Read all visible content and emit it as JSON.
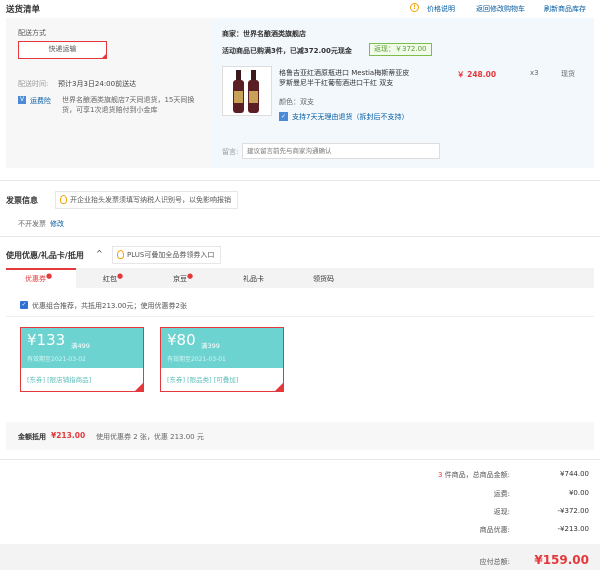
{
  "header": {
    "title": "送货清单",
    "links": [
      "价格说明",
      "返回修改购物车",
      "刷新商品库存"
    ],
    "info_icon": "!"
  },
  "delivery": {
    "label": "配送方式",
    "option": "快递运输",
    "time_label": "配送时间:",
    "time_value": "预计3月3日24:00前送达",
    "insure_icon": "V",
    "insure_label": "运费险",
    "insure_text": "世界名酿酒类旗舰店7天同退货，15天同换货，可享1次退货赔付到小金库"
  },
  "shop": {
    "name": "商家：世界名酿酒类旗舰店",
    "promo": "活动商品已购满3件，已减372.00元现金",
    "rebate": "返现：￥372.00",
    "product": {
      "name": "格鲁吉亚红酒原瓶进口 Mestia梅斯蒂亚皮罗斯曼尼半干红葡萄酒进口干红 双支",
      "price": "￥ 248.00",
      "qty": "x3",
      "stock": "现货",
      "color": "颜色：双支",
      "return_icon": "✓",
      "return_text": "支持7天无理由退货（拆封后不支持）"
    },
    "note_label": "留言:",
    "note_placeholder": "建议留言前先与商家沟通确认"
  },
  "invoice": {
    "title": "发票信息",
    "tip": "开企业抬头发票须填写纳税人识别号，以免影响报销",
    "status": "不开发票",
    "edit": "修改"
  },
  "coupons": {
    "title": "使用优惠/礼品卡/抵用",
    "caret": "^",
    "plus_tip": "PLUS可叠加全品券领券入口",
    "tabs": [
      {
        "label": "优惠券",
        "dot": "●"
      },
      {
        "label": "红包",
        "dot": "●"
      },
      {
        "label": "京豆",
        "dot": "●"
      },
      {
        "label": "礼品卡",
        "dot": ""
      },
      {
        "label": "领货码",
        "dot": ""
      }
    ],
    "check_icon": "✓",
    "combo_text": "优惠组合推荐，共抵用213.00元；使用优惠券2张",
    "items": [
      {
        "amount": "¥133",
        "threshold": "满499",
        "expiry": "有效期至2021-03-02",
        "tags": "[东券]  [限店铺指商品]"
      },
      {
        "amount": "¥80",
        "threshold": "满399",
        "expiry": "有效期至2021-03-01",
        "tags": "[东券]  [限品类]  [可叠加]"
      }
    ],
    "summary_label": "金额抵用",
    "summary_amount": "¥213.00",
    "summary_text": "使用优惠券 2 张，优惠 213.00 元"
  },
  "totals": {
    "count": "3",
    "count_label": "件商品，总商品金额:",
    "goods_amount": "¥744.00",
    "rows": [
      {
        "label": "运费:",
        "value": "¥0.00"
      },
      {
        "label": "返现:",
        "value": "-¥372.00"
      },
      {
        "label": "商品优惠:",
        "value": "-¥213.00"
      }
    ],
    "pay_label": "应付总额:",
    "pay_amount": "¥159.00"
  },
  "colors": {
    "accent": "#e4393c",
    "link": "#005aa0",
    "coupon": "#6dd3d0"
  }
}
